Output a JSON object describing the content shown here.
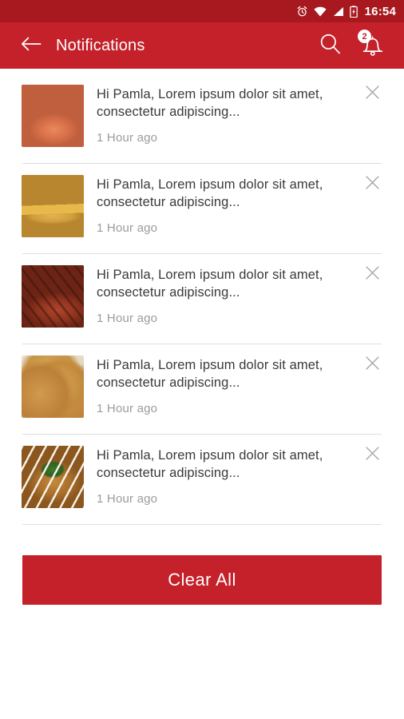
{
  "status_bar": {
    "time": "16:54",
    "icons": [
      "alarm-icon",
      "wifi-icon",
      "cellular-signal-icon",
      "battery-charging-icon"
    ],
    "background_color": "#a8191f"
  },
  "app_bar": {
    "back_label": "back-arrow-icon",
    "title": "Notifications",
    "search_label": "search-icon",
    "bell_label": "notification-bell-icon",
    "bell_badge_count": "2",
    "background_color": "#c4212a",
    "text_color": "#ffffff"
  },
  "notifications": [
    {
      "message": "Hi Pamla, Lorem ipsum dolor sit amet, consectetur adipiscing...",
      "time": "1 Hour ago",
      "thumbnail": "grilled-salmon-with-salad",
      "close_label": "close-icon"
    },
    {
      "message": "Hi Pamla, Lorem ipsum dolor sit amet, consectetur adipiscing...",
      "time": "1 Hour ago",
      "thumbnail": "corn-dogs-with-fries",
      "close_label": "close-icon"
    },
    {
      "message": "Hi Pamla, Lorem ipsum dolor sit amet, consectetur adipiscing...",
      "time": "1 Hour ago",
      "thumbnail": "grilled-bbq-chicken",
      "close_label": "close-icon"
    },
    {
      "message": "Hi Pamla, Lorem ipsum dolor sit amet, consectetur adipiscing...",
      "time": "1 Hour ago",
      "thumbnail": "fried-chicken-platter",
      "close_label": "close-icon"
    },
    {
      "message": "Hi Pamla, Lorem ipsum dolor sit amet, consectetur adipiscing...",
      "time": "1 Hour ago",
      "thumbnail": "okonomiyaki-with-sauce",
      "close_label": "close-icon"
    }
  ],
  "footer": {
    "clear_all_label": "Clear All",
    "button_color": "#c4212a"
  },
  "theme": {
    "primary": "#c4212a",
    "status_bar": "#a8191f",
    "text_primary": "#3a3a3a",
    "text_muted": "#9b9b9b",
    "divider": "#dedede",
    "page_background": "#ffffff"
  }
}
